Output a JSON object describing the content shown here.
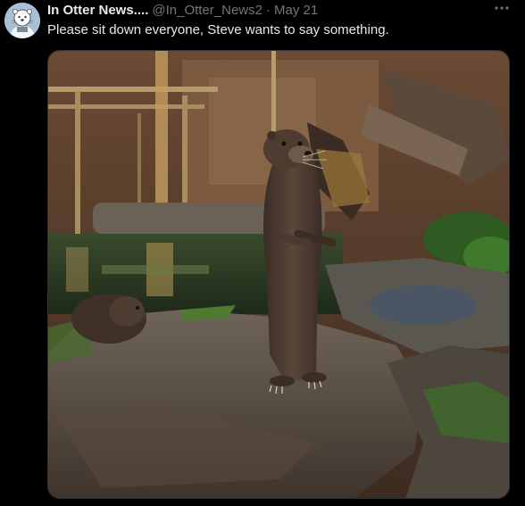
{
  "tweet": {
    "display_name": "In Otter News....",
    "handle": "@In_Otter_News2",
    "separator": "·",
    "date": "May 21",
    "text": "Please sit down everyone, Steve wants to say something.",
    "more_icon": "more-horizontal-icon",
    "avatar_icon": "otter-avatar-icon"
  },
  "colors": {
    "background": "#000000",
    "text_primary": "#e7e9ea",
    "text_secondary": "#71767b"
  }
}
